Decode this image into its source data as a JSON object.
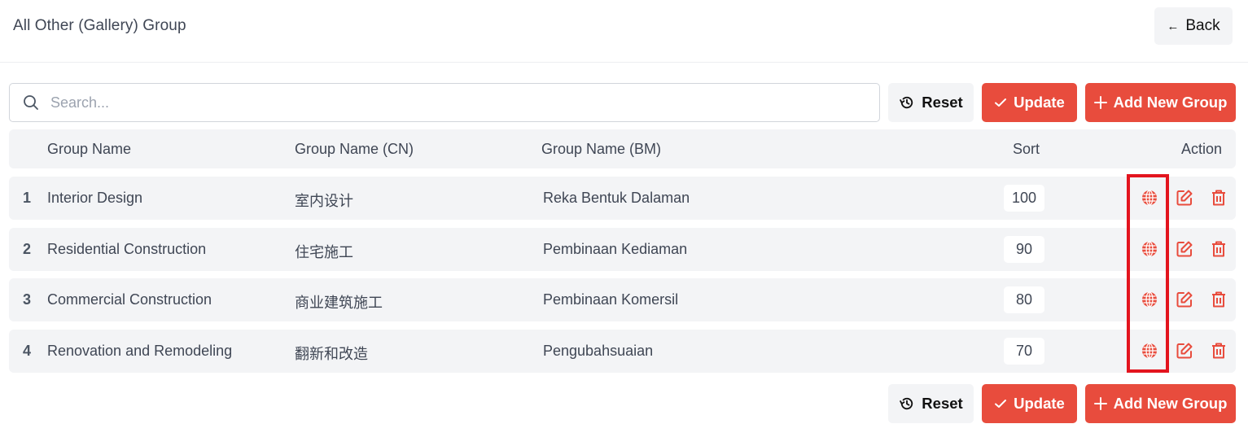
{
  "header": {
    "title": "All Other (Gallery) Group",
    "back_label": "Back",
    "back_icon": "arrow-left-icon"
  },
  "toolbar": {
    "search_placeholder": "Search...",
    "search_value": "",
    "reset_label": "Reset",
    "update_label": "Update",
    "add_label": "Add New Group"
  },
  "table": {
    "columns": [
      "Group Name",
      "Group Name (CN)",
      "Group Name (BM)",
      "Sort",
      "Action"
    ],
    "rows": [
      {
        "index": "1",
        "name": "Interior Design",
        "name_cn": "室内设计",
        "name_bm": "Reka Bentuk Dalaman",
        "sort": "100"
      },
      {
        "index": "2",
        "name": "Residential Construction",
        "name_cn": "住宅施工",
        "name_bm": "Pembinaan Kediaman",
        "sort": "90"
      },
      {
        "index": "3",
        "name": "Commercial Construction",
        "name_cn": "商业建筑施工",
        "name_bm": "Pembinaan Komersil",
        "sort": "80"
      },
      {
        "index": "4",
        "name": "Renovation and Remodeling",
        "name_cn": "翻新和改造",
        "name_bm": "Pengubahsuaian",
        "sort": "70"
      }
    ],
    "action_icons": [
      "globe-icon",
      "edit-icon",
      "trash-icon"
    ]
  },
  "footer": {
    "reset_label": "Reset",
    "update_label": "Update",
    "add_label": "Add New Group"
  },
  "colors": {
    "accent": "#e84c3d",
    "highlight": "#e3141e",
    "row_bg": "#f3f4f6"
  }
}
